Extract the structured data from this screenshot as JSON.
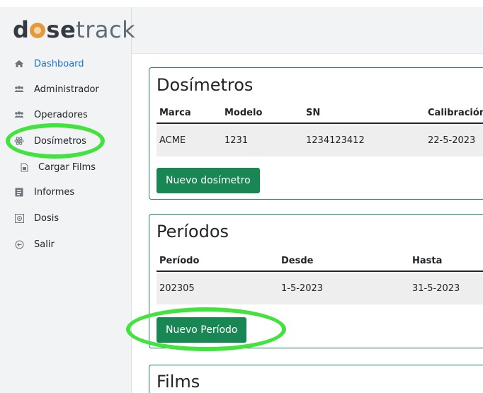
{
  "brand": {
    "logo_d": "d",
    "logo_se": "se",
    "logo_track": "track"
  },
  "sidebar": {
    "items": [
      {
        "label": "Dashboard",
        "icon": "home-icon"
      },
      {
        "label": "Administrador",
        "icon": "users-icon"
      },
      {
        "label": "Operadores",
        "icon": "users-icon"
      },
      {
        "label": "Dosímetros",
        "icon": "atom-icon"
      },
      {
        "label": "Cargar Films",
        "icon": "file-icon"
      },
      {
        "label": "Informes",
        "icon": "report-icon"
      },
      {
        "label": "Dosis",
        "icon": "chart-icon"
      },
      {
        "label": "Salir",
        "icon": "logout-icon"
      }
    ]
  },
  "dosimetros": {
    "title": "Dosímetros",
    "columns": [
      "Marca",
      "Modelo",
      "SN",
      "Calibración"
    ],
    "rows": [
      [
        "ACME",
        "1231",
        "1234123412",
        "22-5-2023"
      ]
    ],
    "button": "Nuevo dosímetro"
  },
  "periodos": {
    "title": "Períodos",
    "columns": [
      "Período",
      "Desde",
      "Hasta"
    ],
    "rows": [
      [
        "202305",
        "1-5-2023",
        "31-5-2023"
      ]
    ],
    "button": "Nuevo Período"
  },
  "films": {
    "title": "Films"
  },
  "colors": {
    "accent": "#198754",
    "link": "#1c71c9",
    "highlight": "#43e33f"
  }
}
